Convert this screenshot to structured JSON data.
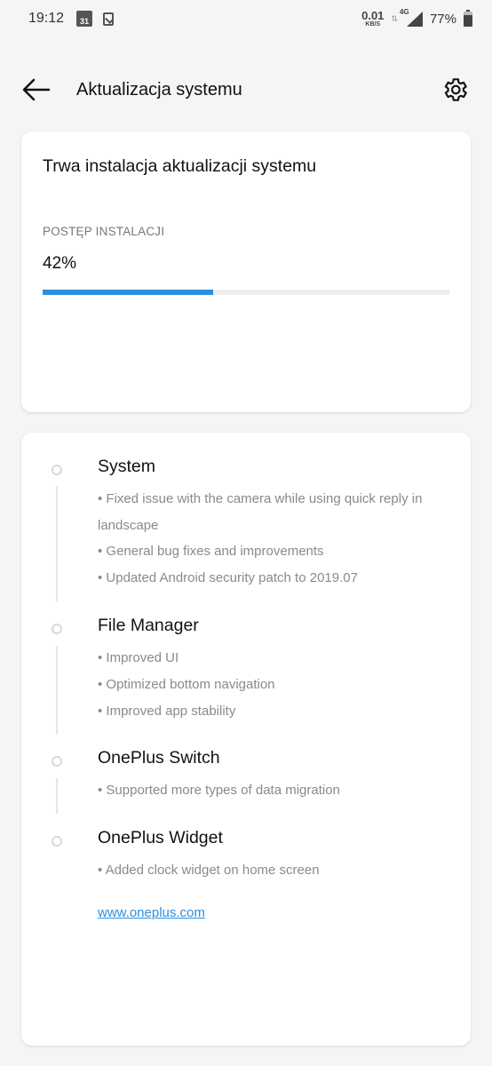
{
  "status_bar": {
    "time": "19:12",
    "calendar_day": "31",
    "net_speed": "0.01",
    "net_speed_unit": "KB/S",
    "network_type": "4G",
    "battery": "77%"
  },
  "app_bar": {
    "title": "Aktualizacja systemu",
    "back_icon": "arrow-back-icon",
    "settings_icon": "gear-icon"
  },
  "install_card": {
    "title": "Trwa instalacja aktualizacji systemu",
    "progress_label": "POSTĘP INSTALACJI",
    "progress_text": "42%",
    "progress_fraction": 0.42,
    "accent_color": "#2e8fe0"
  },
  "changelog": {
    "sections": [
      {
        "title": "System",
        "items": [
          "• Fixed issue with the camera while using quick reply in landscape",
          "• General bug fixes and improvements",
          "• Updated Android security patch to 2019.07"
        ]
      },
      {
        "title": "File Manager",
        "items": [
          "• Improved UI",
          "• Optimized bottom navigation",
          "• Improved app stability"
        ]
      },
      {
        "title": "OnePlus Switch",
        "items": [
          "• Supported more types of data migration"
        ]
      },
      {
        "title": "OnePlus Widget",
        "items": [
          "• Added clock widget on home screen"
        ]
      }
    ],
    "link": "www.oneplus.com"
  }
}
